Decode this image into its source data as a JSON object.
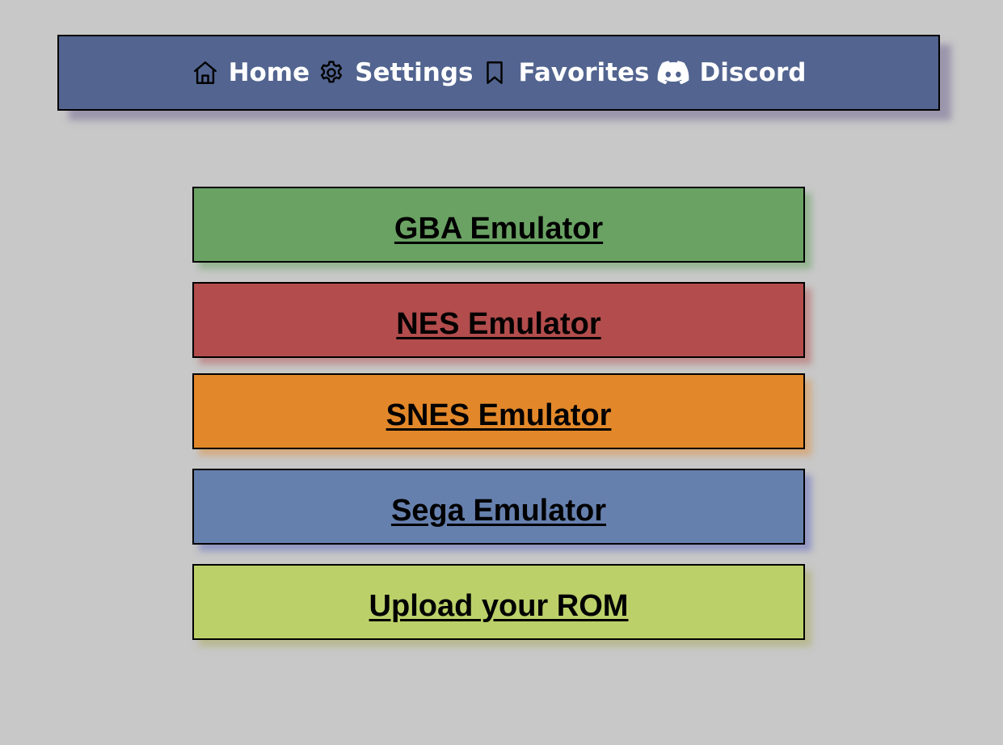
{
  "nav": {
    "bg_color": "#52648f",
    "items": [
      {
        "label": "Home",
        "icon": "home-icon"
      },
      {
        "label": "Settings",
        "icon": "gear-icon"
      },
      {
        "label": "Favorites",
        "icon": "bookmark-icon"
      },
      {
        "label": "Discord",
        "icon": "discord-icon"
      }
    ]
  },
  "emulators": [
    {
      "label": "GBA Emulator",
      "color": "#6aa263",
      "shadow": "rgba(106,162,99,0.55)"
    },
    {
      "label": "NES Emulator",
      "color": "#b34c4c",
      "shadow": "rgba(179,76,76,0.45)"
    },
    {
      "label": "SNES Emulator",
      "color": "#e2882a",
      "shadow": "rgba(226,136,42,0.45)"
    },
    {
      "label": "Sega Emulator",
      "color": "#6680ae",
      "shadow": "rgba(102,110,190,0.55)"
    },
    {
      "label": "Upload your ROM",
      "color": "#bbd069",
      "shadow": "rgba(170,170,90,0.5)"
    }
  ]
}
